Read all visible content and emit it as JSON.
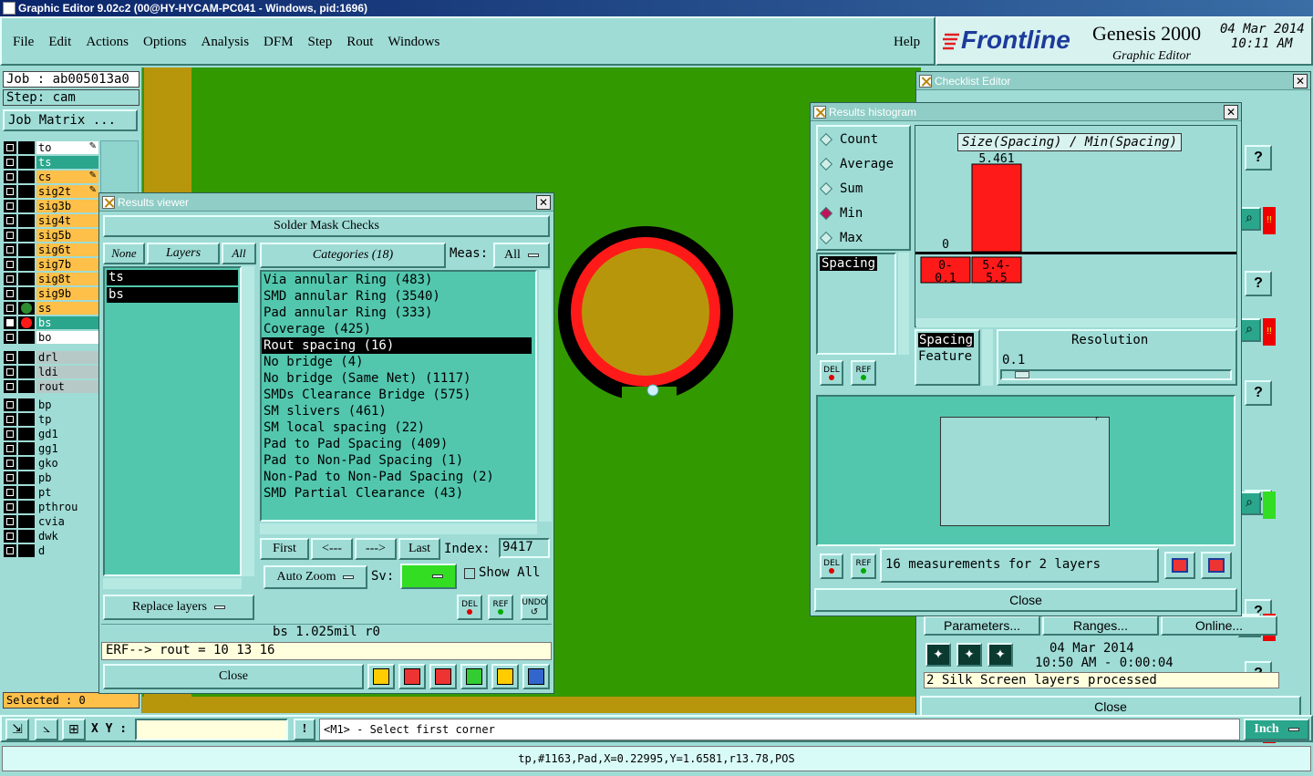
{
  "window_title": "Graphic Editor 9.02c2 (00@HY-HYCAM-PC041 - Windows, pid:1696)",
  "menu": [
    "File",
    "Edit",
    "Actions",
    "Options",
    "Analysis",
    "DFM",
    "Step",
    "Rout",
    "Windows"
  ],
  "help": "Help",
  "brand": {
    "logo": "Frontline",
    "product": "Genesis 2000",
    "subtitle": "Graphic Editor",
    "date": "04 Mar 2014",
    "time": "10:11 AM"
  },
  "job": {
    "job_label": "Job : ab005013a0",
    "step_label": "Step: cam",
    "matrix_button": "Job Matrix ..."
  },
  "layers_group1": [
    {
      "name": "to",
      "bg": "#ffffff",
      "mark": "✎"
    },
    {
      "name": "ts",
      "bg": "#2aa68c",
      "mark": ""
    },
    {
      "name": "cs",
      "bg": "#ffc04a",
      "mark": "✎"
    },
    {
      "name": "sig2t",
      "bg": "#ffc04a",
      "mark": "✎"
    },
    {
      "name": "sig3b",
      "bg": "#ffc04a",
      "mark": ""
    },
    {
      "name": "sig4t",
      "bg": "#ffc04a",
      "mark": ""
    },
    {
      "name": "sig5b",
      "bg": "#ffc04a",
      "mark": ""
    },
    {
      "name": "sig6t",
      "bg": "#ffc04a",
      "mark": ""
    },
    {
      "name": "sig7b",
      "bg": "#ffc04a",
      "mark": ""
    },
    {
      "name": "sig8t",
      "bg": "#ffc04a",
      "mark": ""
    },
    {
      "name": "sig9b",
      "bg": "#ffc04a",
      "mark": ""
    },
    {
      "name": "ss",
      "bg": "#ffc04a",
      "mark": ""
    },
    {
      "name": "bs",
      "bg": "#2aa68c",
      "mark": ""
    },
    {
      "name": "bo",
      "bg": "#ffffff",
      "mark": ""
    }
  ],
  "layers_group2": [
    "drl",
    "ldi",
    "rout"
  ],
  "layers_group3": [
    "bp",
    "tp",
    "gd1",
    "gg1",
    "gko",
    "pb",
    "pt",
    "pthrou",
    "cvia",
    "dwk",
    "d"
  ],
  "selected": "Selected : 0",
  "results_viewer": {
    "title": "Results viewer",
    "header": "Solder Mask Checks",
    "none": "None",
    "layers": "Layers",
    "all": "All",
    "layer_list": [
      "ts",
      "bs"
    ],
    "categories_button": "Categories (18)",
    "meas_label": "Meas:",
    "meas_value": "All",
    "categories": [
      "Via annular Ring (483)",
      "SMD annular Ring (3540)",
      "Pad annular Ring (333)",
      "Coverage (425)",
      "Rout spacing (16)",
      "No bridge (4)",
      "No bridge (Same Net) (1117)",
      "SMDs Clearance Bridge (575)",
      "SM slivers (461)",
      "SM local spacing (22)",
      "Pad to Pad Spacing (409)",
      "Pad to Non-Pad Spacing (1)",
      "Non-Pad to Non-Pad Spacing (2)",
      "SMD Partial Clearance (43)"
    ],
    "selected_category": 4,
    "first": "First",
    "prev": "<---",
    "next": "--->",
    "last": "Last",
    "index_label": "Index:",
    "index_value": "9417",
    "auto_zoom": "Auto Zoom",
    "sv_label": "Sv:",
    "show_all": "Show All",
    "replace_layers": "Replace layers",
    "del": "DEL",
    "ref": "REF",
    "undo": "UNDO",
    "status": "bs 1.025mil  r0",
    "erf": "ERF--> rout = 10 13 16",
    "close": "Close"
  },
  "histogram": {
    "title": "Results histogram",
    "modes": [
      "Count",
      "Average",
      "Sum",
      "Min",
      "Max"
    ],
    "selected_mode": "Min",
    "metric_list": [
      "Spacing"
    ],
    "chart_title": "Size(Spacing) / Min(Spacing)",
    "bar_value": "5.461",
    "zero_label": "0",
    "bins": [
      {
        "label": "0-\n0.1",
        "value": 0
      },
      {
        "label": "5.4-\n5.5",
        "value": 5.461
      }
    ],
    "spacing_label": "Spacing",
    "feature_label": "Feature",
    "resolution_label": "Resolution",
    "resolution_value": "0.1",
    "measurements": "16 measurements for 2 layers",
    "del": "DEL",
    "ref": "REF",
    "close": "Close"
  },
  "checklist": {
    "title": "Checklist Editor",
    "parameters": "Parameters...",
    "ranges": "Ranges...",
    "online": "Online...",
    "date": "04 Mar 2014",
    "time": "10:50 AM - 0:00:04",
    "status": "2 Silk Screen layers processed",
    "close": "Close",
    "question_marks": [
      "?",
      "?",
      "?",
      "?",
      "?",
      "?"
    ],
    "exclaim": "!!"
  },
  "bottom": {
    "xy_label": "X Y :",
    "xy_value": "",
    "exclaim": "!",
    "prompt": "<M1> - Select first corner",
    "units": "Inch",
    "statusline": "tp,#1163,Pad,X=0.22995,Y=1.6581,r13.78,POS"
  },
  "colors": {
    "board": "#339900",
    "copper": "#b8960b",
    "ring": "#ff1a1a",
    "accent": "#2aa68c"
  }
}
